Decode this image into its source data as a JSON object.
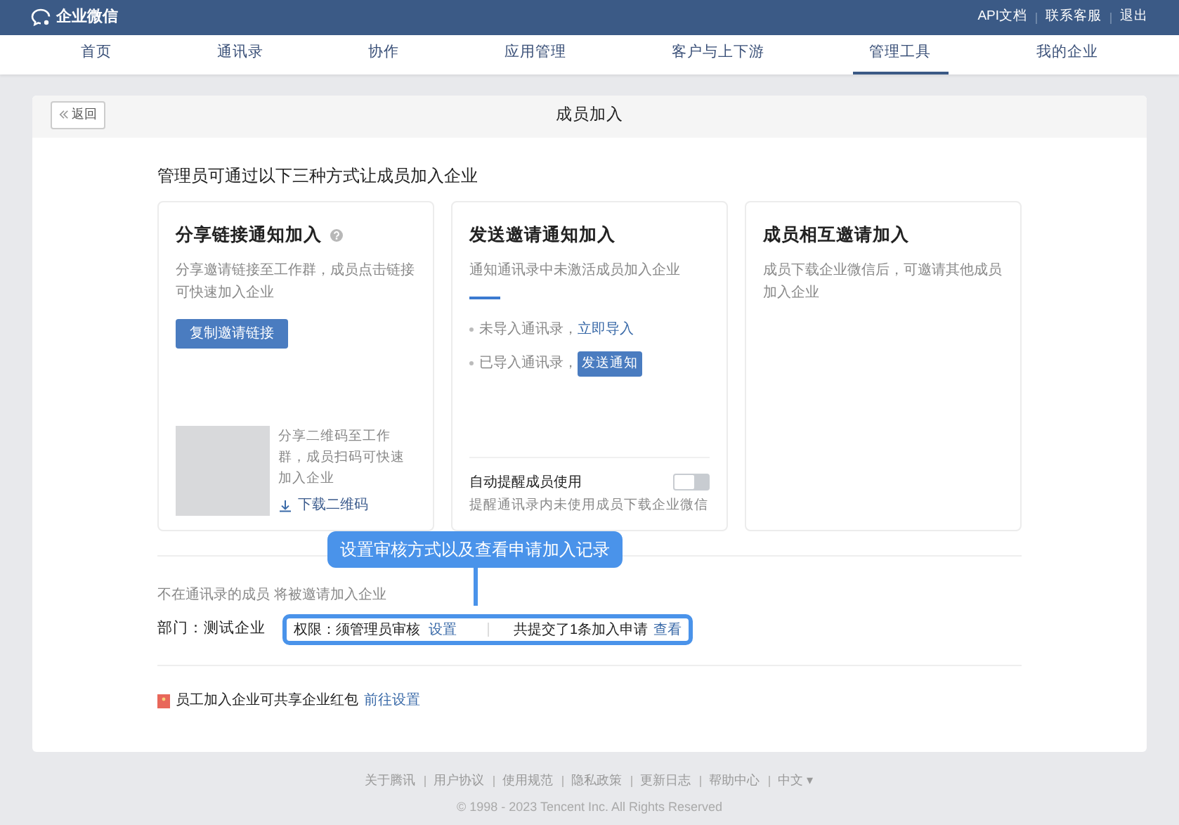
{
  "top_bar": {
    "logo": "企业微信",
    "links": [
      "API文档",
      "联系客服",
      "退出"
    ]
  },
  "nav": [
    {
      "label": "首页",
      "selected": false
    },
    {
      "label": "通讯录",
      "selected": false
    },
    {
      "label": "协作",
      "selected": false
    },
    {
      "label": "应用管理",
      "selected": false
    },
    {
      "label": "客户与上下游",
      "selected": false
    },
    {
      "label": "管理工具",
      "selected": true
    },
    {
      "label": "我的企业",
      "selected": false
    }
  ],
  "panel": {
    "back": "返回",
    "title": "成员加入",
    "intro": "管理员可通过以下三种方式让成员加入企业"
  },
  "methods": [
    {
      "kind": "link",
      "title": "分享链接通知加入",
      "desc": "分享邀请链接至工作群，成员点击链接可快速加入企业",
      "button": "复制邀请链接",
      "qr_text": "分享二维码至工作群，成员扫码可快速加入企业",
      "qr_link": "下载二维码"
    },
    {
      "kind": "invite",
      "title": "发送邀请通知加入",
      "desc": "通知通讯录中未激活成员加入企业",
      "item_1": "未导入通讯录，",
      "item_1_link": "立即导入",
      "item_2": "已导入通讯录，",
      "item_2_button": "发送通知",
      "toggle_label": "自动提醒成员使用",
      "toggle_on": false,
      "toggle_desc": "提醒通讯录内未使用成员下载企业微信"
    },
    {
      "kind": "mutual",
      "title": "成员相互邀请加入",
      "desc": "成员下载企业微信后，可邀请其他成员加入企业"
    }
  ],
  "callout": "设置审核方式以及查看申请加入记录",
  "not_in_contacts": "不在通讯录的成员 将被邀请加入企业",
  "department": "部门：测试企业",
  "permission": {
    "label": "权限：须管理员审核",
    "link": "设置",
    "count": "共提交了1条加入申请",
    "count_link": "查看"
  },
  "red_packet": {
    "text": "员工加入企业可共享企业红包",
    "link": "前往设置"
  },
  "footer": {
    "links": [
      "关于腾讯",
      "用户协议",
      "使用规范",
      "隐私政策",
      "更新日志",
      "帮助中心",
      "中文 ▾"
    ],
    "copyright": "© 1998 - 2023 Tencent Inc. All Rights Reserved"
  }
}
